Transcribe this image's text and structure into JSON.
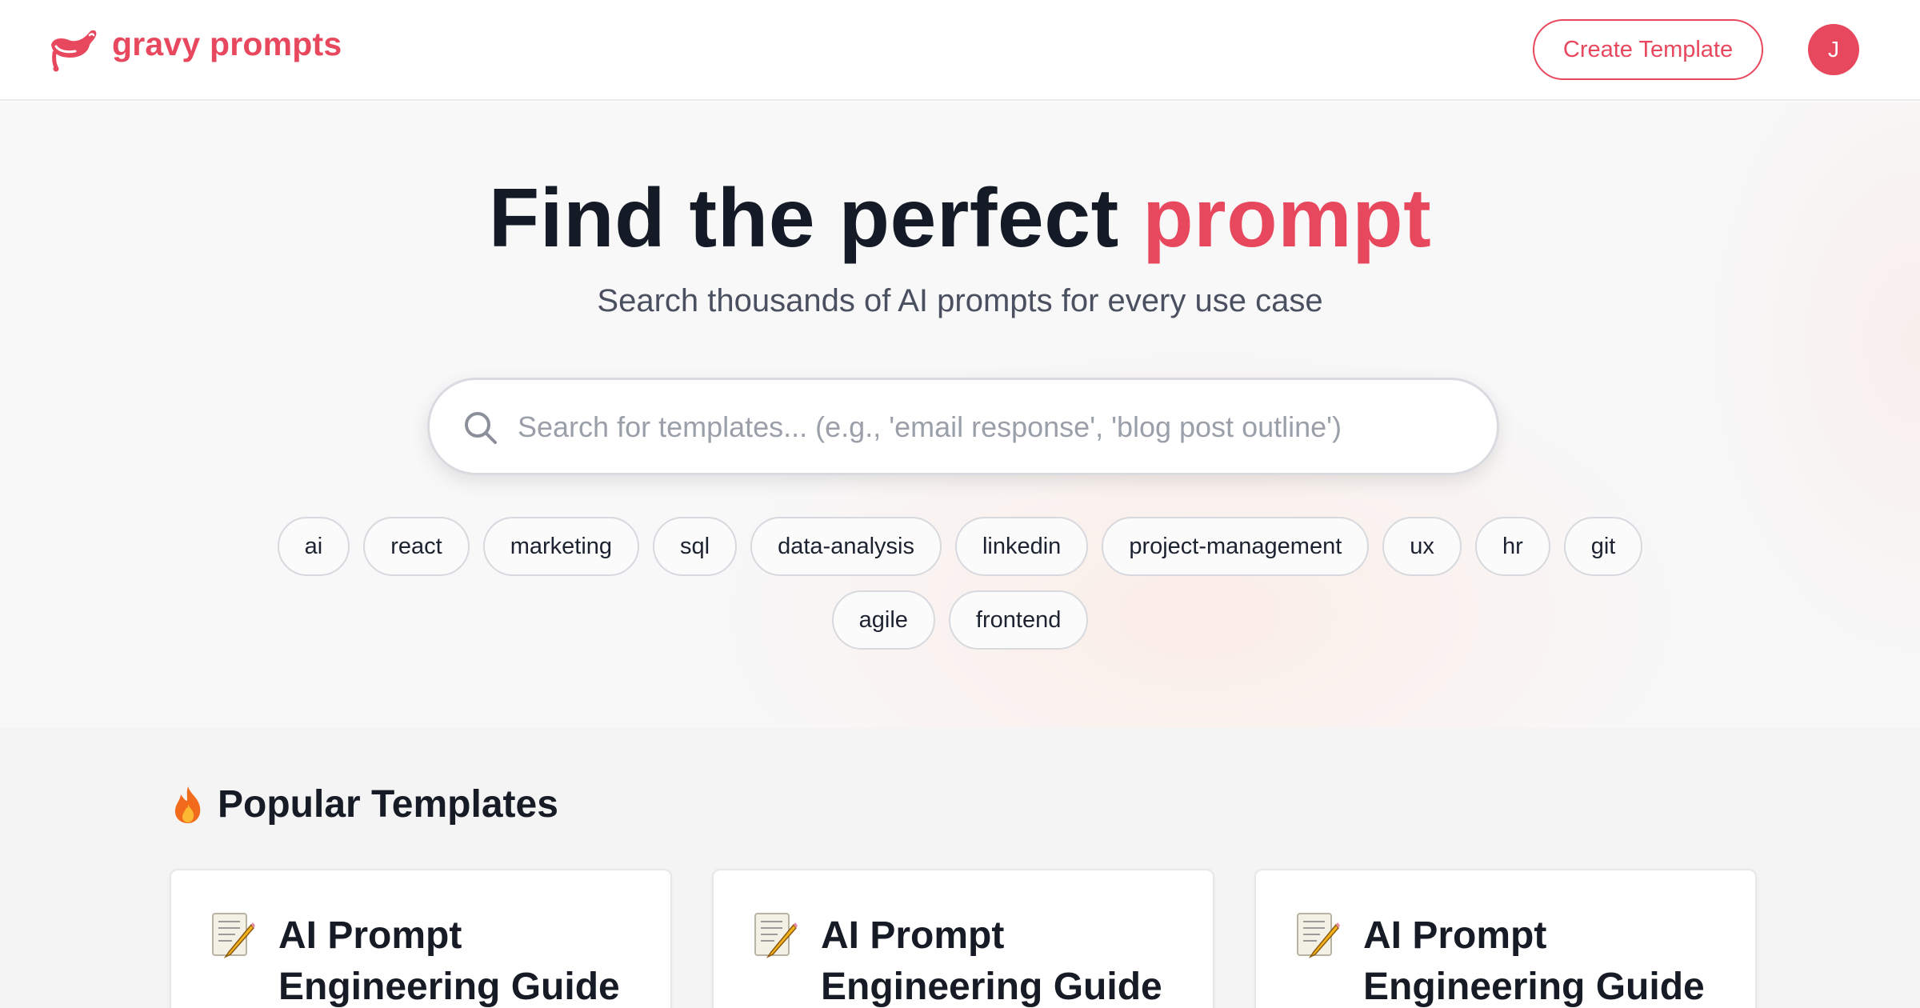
{
  "header": {
    "brand": "gravy prompts",
    "create_label": "Create Template",
    "avatar_initial": "J"
  },
  "hero": {
    "title_main": "Find the perfect ",
    "title_accent": "prompt",
    "subtitle": "Search thousands of AI prompts for every use case",
    "search_placeholder": "Search for templates... (e.g., 'email response', 'blog post outline')",
    "tags_row1": [
      "ai",
      "react",
      "marketing",
      "sql",
      "data-analysis",
      "linkedin",
      "project-management",
      "ux",
      "hr",
      "git"
    ],
    "tags_row2": [
      "agile",
      "frontend"
    ]
  },
  "popular": {
    "title": "Popular Templates",
    "cards": [
      {
        "icon": "memo-icon",
        "title": "AI Prompt Engineering Guide"
      },
      {
        "icon": "memo-icon",
        "title": "AI Prompt Engineering Guide"
      },
      {
        "icon": "memo-icon",
        "title": "AI Prompt Engineering Guide"
      }
    ]
  },
  "colors": {
    "accent": "#e8485e",
    "text": "#161b26",
    "muted": "#4a5060"
  }
}
